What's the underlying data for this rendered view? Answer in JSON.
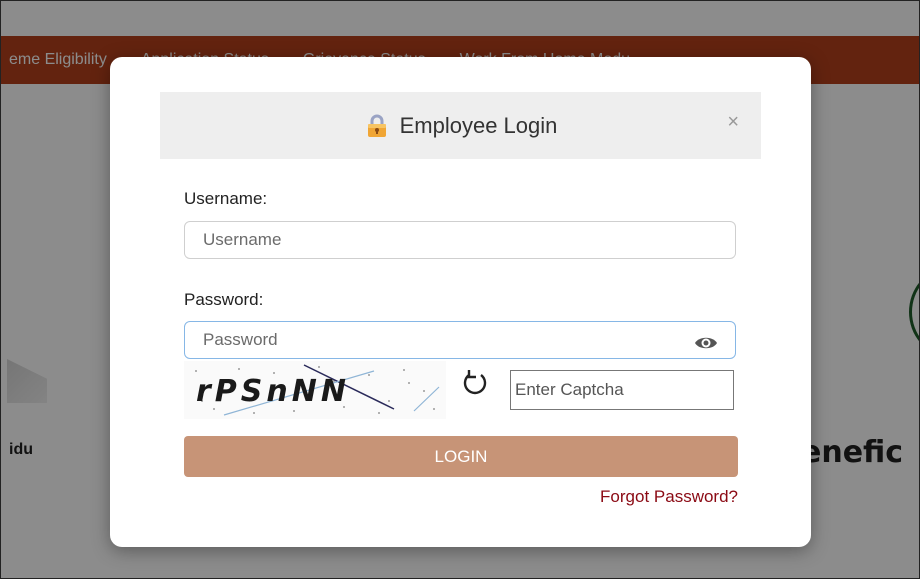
{
  "background": {
    "nav_items": [
      "eme Eligibility",
      "Application Status",
      "Grievance Status",
      "Work From Home Modu"
    ],
    "left_text": "idu",
    "right_text": "enefic"
  },
  "modal": {
    "title": "Employee Login",
    "title_icon": "lock-icon",
    "close_symbol": "×",
    "username_label": "Username:",
    "username_placeholder": "Username",
    "password_label": "Password:",
    "password_placeholder": "Password",
    "captcha_text": "rPSnNN",
    "captcha_placeholder": "Enter Captcha",
    "login_label": "LOGIN",
    "forgot_label": "Forgot Password?"
  },
  "colors": {
    "nav_bg": "#b5411d",
    "login_button": "#c79477",
    "forgot_link": "#8b0a14"
  }
}
